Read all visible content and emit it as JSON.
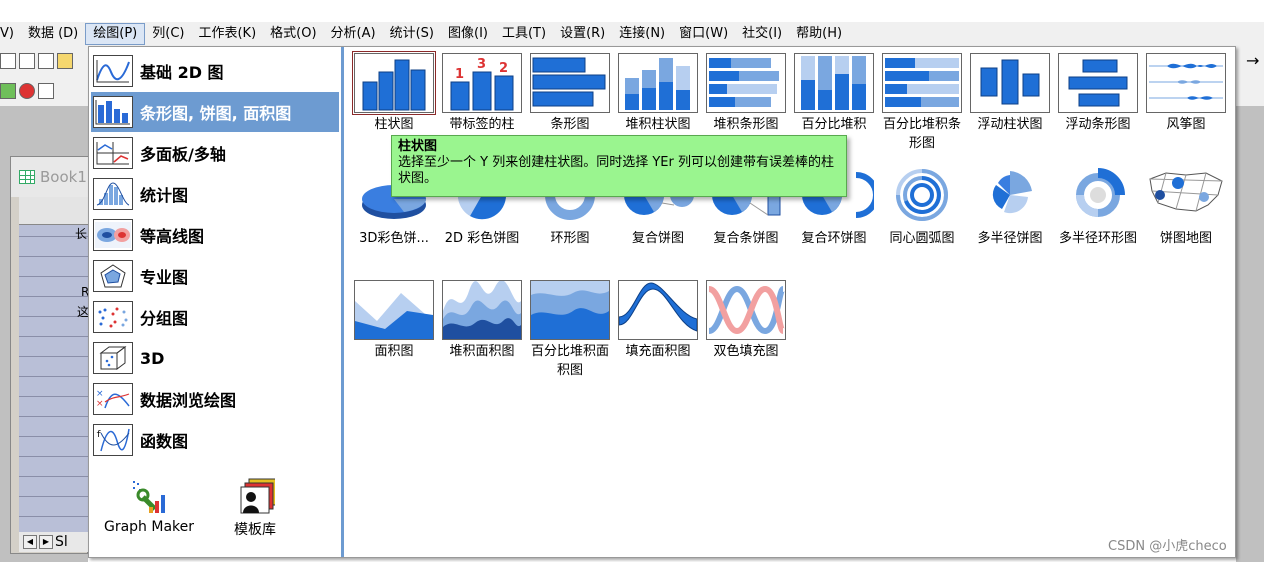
{
  "menu": {
    "items": [
      {
        "label": "V)"
      },
      {
        "label": "数据 (D)"
      },
      {
        "label": "绘图(P)"
      },
      {
        "label": "列(C)"
      },
      {
        "label": "工作表(K)"
      },
      {
        "label": "格式(O)"
      },
      {
        "label": "分析(A)"
      },
      {
        "label": "统计(S)"
      },
      {
        "label": "图像(I)"
      },
      {
        "label": "工具(T)"
      },
      {
        "label": "设置(R)"
      },
      {
        "label": "连接(N)"
      },
      {
        "label": "窗口(W)"
      },
      {
        "label": "社交(I)"
      },
      {
        "label": "帮助(H)"
      }
    ]
  },
  "background": {
    "book_title": "Book1",
    "sheet_tab": "Sl",
    "fragments": [
      "长",
      "R",
      "这"
    ]
  },
  "categories": [
    {
      "label": "基础 2D 图",
      "icon": "line-chart-icon"
    },
    {
      "label": "条形图, 饼图, 面积图",
      "icon": "bar-chart-icon"
    },
    {
      "label": "多面板/多轴",
      "icon": "multi-panel-icon"
    },
    {
      "label": "统计图",
      "icon": "histogram-icon"
    },
    {
      "label": "等高线图",
      "icon": "contour-icon"
    },
    {
      "label": "专业图",
      "icon": "radar-icon"
    },
    {
      "label": "分组图",
      "icon": "group-scatter-icon"
    },
    {
      "label": "3D",
      "icon": "cube-icon"
    },
    {
      "label": "数据浏览绘图",
      "icon": "data-explore-icon"
    },
    {
      "label": "函数图",
      "icon": "function-plot-icon"
    }
  ],
  "selected_category": 1,
  "extras": {
    "graph_maker": "Graph Maker",
    "template_library": "模板库"
  },
  "charts": [
    {
      "label": "柱状图",
      "icon": "column-chart-icon"
    },
    {
      "label": "带标签的柱",
      "icon": "labeled-column-icon"
    },
    {
      "label": "条形图",
      "icon": "bar-chart-icon"
    },
    {
      "label": "堆积柱状图",
      "icon": "stacked-column-icon"
    },
    {
      "label": "堆积条形图",
      "icon": "stacked-bar-icon"
    },
    {
      "label": "百分比堆积",
      "icon": "percent-stacked-column-icon"
    },
    {
      "label": "百分比堆积条形图",
      "icon": "percent-stacked-bar-icon"
    },
    {
      "label": "浮动柱状图",
      "icon": "floating-column-icon"
    },
    {
      "label": "浮动条形图",
      "icon": "floating-bar-icon"
    },
    {
      "label": "风筝图",
      "icon": "kite-chart-icon"
    },
    {
      "label": "3D彩色饼...",
      "icon": "pie-3d-icon"
    },
    {
      "label": "2D 彩色饼图",
      "icon": "pie-2d-icon"
    },
    {
      "label": "环形图",
      "icon": "donut-icon"
    },
    {
      "label": "复合饼图",
      "icon": "pie-of-pie-icon"
    },
    {
      "label": "复合条饼图",
      "icon": "bar-of-pie-icon"
    },
    {
      "label": "复合环饼图",
      "icon": "ring-of-pie-icon"
    },
    {
      "label": "同心圆弧图",
      "icon": "concentric-arc-icon"
    },
    {
      "label": "多半径饼图",
      "icon": "multi-radius-pie-icon"
    },
    {
      "label": "多半径环形图",
      "icon": "multi-radius-donut-icon"
    },
    {
      "label": "饼图地图",
      "icon": "pie-map-icon"
    },
    {
      "label": "面积图",
      "icon": "area-chart-icon"
    },
    {
      "label": "堆积面积图",
      "icon": "stacked-area-icon"
    },
    {
      "label": "百分比堆积面积图",
      "icon": "percent-stacked-area-icon"
    },
    {
      "label": "填充面积图",
      "icon": "fill-area-icon"
    },
    {
      "label": "双色填充图",
      "icon": "two-color-fill-icon"
    }
  ],
  "tooltip": {
    "title": "柱状图",
    "body": "选择至少一个 Y 列来创建柱状图。同时选择 YEr 列可以创建带有误差棒的柱状图。"
  },
  "watermark": "CSDN @小虎checo",
  "colors": {
    "accent": "#6d9bd1",
    "bar_blue": "#1f6fd6",
    "tooltip_bg": "#9af58f"
  }
}
